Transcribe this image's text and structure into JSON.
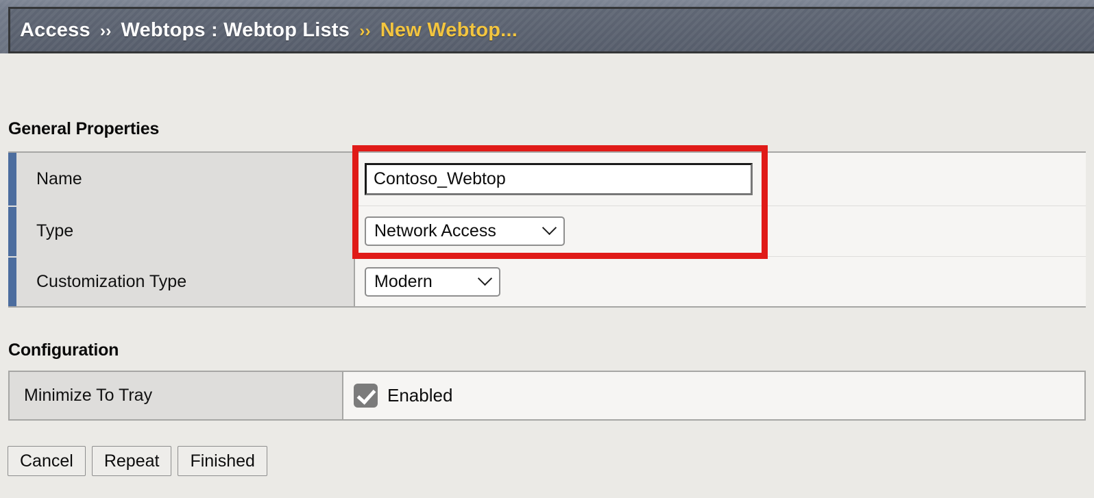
{
  "header": {
    "breadcrumb": [
      {
        "label": "Access",
        "current": false
      },
      {
        "label": "Webtops : Webtop Lists",
        "current": false
      },
      {
        "label": "New Webtop...",
        "current": true
      }
    ],
    "separator": "››",
    "colors": {
      "bar_background": "#5f6674",
      "text": "#ffffff",
      "current_text": "#f3c53f",
      "border": "#343638"
    }
  },
  "sections": {
    "general": {
      "title": "General Properties",
      "rows": [
        {
          "label": "Name",
          "control": "text",
          "value": "Contoso_Webtop"
        },
        {
          "label": "Type",
          "control": "select",
          "value": "Network Access"
        },
        {
          "label": "Customization Type",
          "control": "select",
          "value": "Modern"
        }
      ]
    },
    "configuration": {
      "title": "Configuration",
      "rows": [
        {
          "label": "Minimize To Tray",
          "control": "checkbox",
          "checked": true,
          "checkbox_label": "Enabled"
        }
      ]
    }
  },
  "annotation": {
    "type": "highlight-rectangle",
    "color": "#e01b18",
    "targets": [
      "Name",
      "Type"
    ]
  },
  "buttons": [
    {
      "label": "Cancel",
      "name": "cancel-button"
    },
    {
      "label": "Repeat",
      "name": "repeat-button"
    },
    {
      "label": "Finished",
      "name": "finished-button"
    }
  ],
  "theme": {
    "page_background": "#ebeae6",
    "row_accent": "#4c6d9e",
    "label_cell_background": "#dedddb",
    "value_cell_background": "#f6f5f3",
    "table_border": "#a6a6a4"
  }
}
